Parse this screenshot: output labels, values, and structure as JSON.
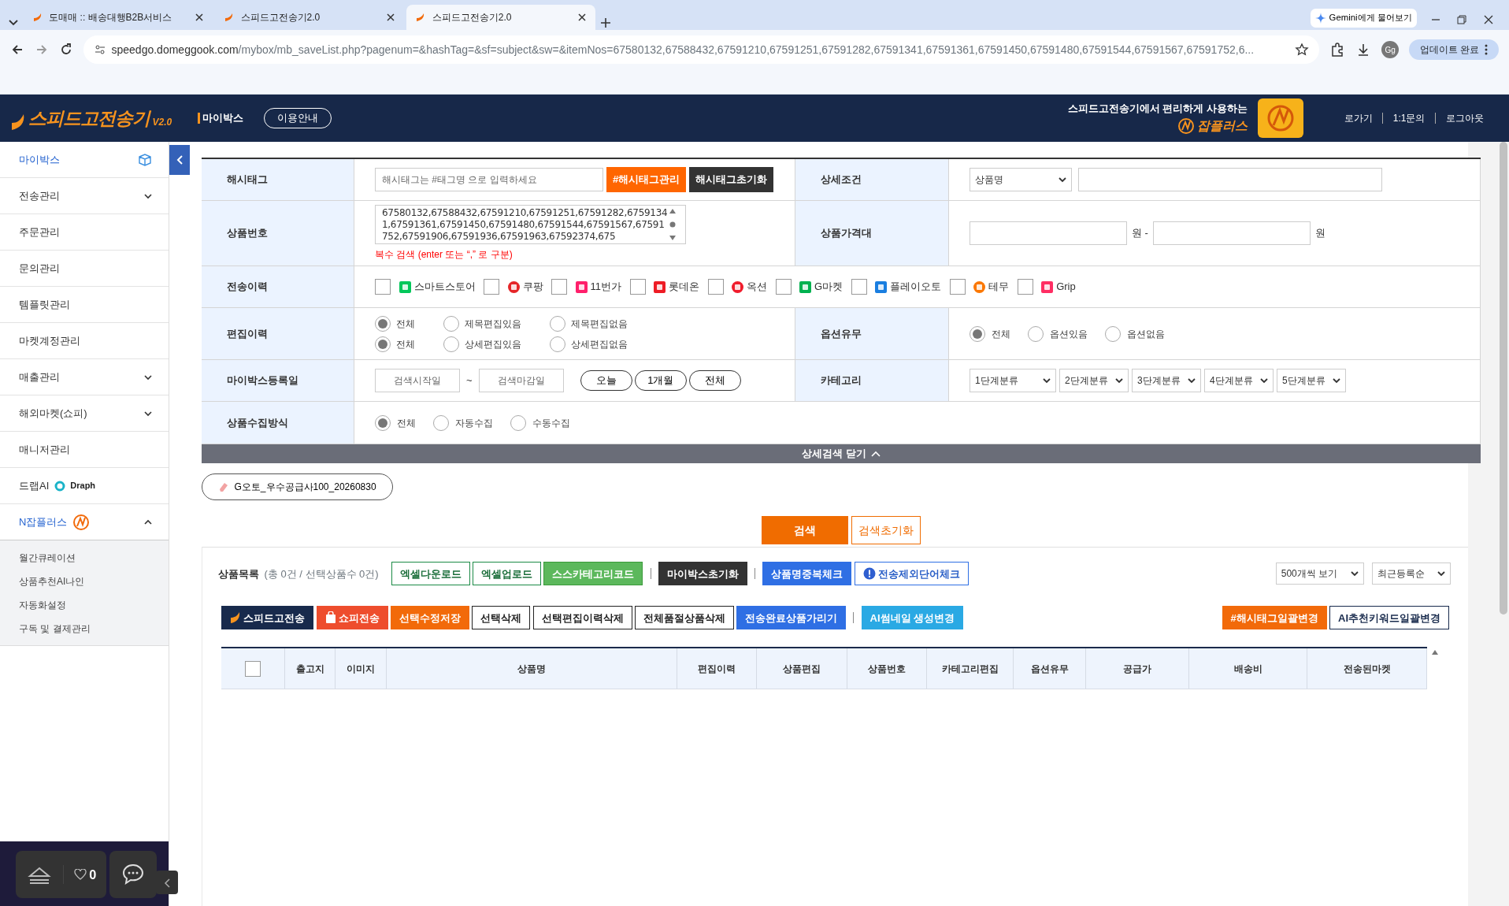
{
  "browser": {
    "tabs": [
      {
        "title": "도매매 :: 배송대행B2B서비스",
        "selected": false
      },
      {
        "title": "스피드고전송기2.0",
        "selected": false
      },
      {
        "title": "스피드고전송기2.0",
        "selected": true
      }
    ],
    "gemini": "Gemini에게 물어보기",
    "url_host": "speedgo.domeggook.com",
    "url_path": "/mybox/mb_saveList.php?pagenum=&hashTag=&sf=subject&sw=&itemNos=67580132,67588432,67591210,67591251,67591282,67591341,67591361,67591450,67591480,67591544,67591567,67591752,6...",
    "profile": "Gg",
    "update_button": "업데이트 완료"
  },
  "header": {
    "logo": "스피드고전송기",
    "version": "V2.0",
    "section": "마이박스",
    "guide_button": "이용안내",
    "promo_text": "스피드고전송기에서 편리하게 사용하는",
    "promo_brand": "잡플러스",
    "links": [
      "로가기",
      "1:1문의",
      "로그아웃"
    ]
  },
  "sidebar": {
    "items": [
      {
        "label": "마이박스",
        "kind": "home",
        "selected": true
      },
      {
        "label": "전송관리",
        "kind": "group",
        "selected": false,
        "expanded": false
      },
      {
        "label": "주문관리",
        "kind": "link",
        "selected": false
      },
      {
        "label": "문의관리",
        "kind": "link",
        "selected": false
      },
      {
        "label": "템플릿관리",
        "kind": "link",
        "selected": false
      },
      {
        "label": "마켓계정관리",
        "kind": "link",
        "selected": false
      },
      {
        "label": "매출관리",
        "kind": "group",
        "selected": false,
        "expanded": false
      },
      {
        "label": "해외마켓(쇼피)",
        "kind": "group",
        "selected": false,
        "expanded": false
      },
      {
        "label": "매니저관리",
        "kind": "link",
        "selected": false
      },
      {
        "label": "드랩AI",
        "kind": "draph",
        "brand": "Draph",
        "selected": false
      },
      {
        "label": "N잡플러스",
        "kind": "group",
        "selected": true,
        "expanded": true,
        "children": [
          "월간큐레이션",
          "상품추천AI나인",
          "자동화설정",
          "구독 및 결제관리"
        ]
      }
    ]
  },
  "search_form": {
    "hashtag": {
      "label": "해시태그",
      "placeholder": "해시태그는 #태그명 으로 입력하세요",
      "buttons": [
        "#해시태그관리",
        "해시태그초기화"
      ]
    },
    "detail": {
      "label": "상세조건",
      "select": "상품명"
    },
    "product_no": {
      "label": "상품번호",
      "value": "67580132,67588432,67591210,67591251,67591282,67591341,67591361,67591450,67591480,67591544,67591567,67591752,67591906,67591936,67591963,67592374,675",
      "hint": "복수 검색 (enter 또는 “,” 로 구분)"
    },
    "price": {
      "label": "상품가격대",
      "units": [
        "원 -",
        "원"
      ]
    },
    "markets": {
      "label": "전송이력",
      "items": [
        {
          "name": "스마트스토어",
          "checked": false,
          "color": "#03c75a"
        },
        {
          "name": "쿠팡",
          "checked": false,
          "color": "#e52528"
        },
        {
          "name": "11번가",
          "checked": false,
          "color": "#ff1f6b"
        },
        {
          "name": "롯데온",
          "checked": false,
          "color": "#ee1c25"
        },
        {
          "name": "옥션",
          "checked": false,
          "color": "#f01c2c"
        },
        {
          "name": "G마켓",
          "checked": false,
          "color": "#00b14f"
        },
        {
          "name": "플레이오토",
          "checked": false,
          "color": "#1a7ee0"
        },
        {
          "name": "테무",
          "checked": false,
          "color": "#fb7701"
        },
        {
          "name": "Grip",
          "checked": false,
          "color": "#ff2e63"
        }
      ]
    },
    "edit_history": {
      "label": "편집이력",
      "groups": [
        [
          {
            "label": "전체",
            "selected": true
          },
          {
            "label": "제목편집있음",
            "selected": false
          },
          {
            "label": "제목편집없음",
            "selected": false
          }
        ],
        [
          {
            "label": "전체",
            "selected": true
          },
          {
            "label": "상세편집있음",
            "selected": false
          },
          {
            "label": "상세편집없음",
            "selected": false
          }
        ]
      ]
    },
    "option": {
      "label": "옵션유무",
      "options": [
        {
          "label": "전체",
          "selected": true
        },
        {
          "label": "옵션있음",
          "selected": false
        },
        {
          "label": "옵션없음",
          "selected": false
        }
      ]
    },
    "registered": {
      "label": "마이박스등록일",
      "start_placeholder": "검색시작일",
      "tilde": "~",
      "end_placeholder": "검색마감일",
      "ranges": [
        "오늘",
        "1개월",
        "전체"
      ]
    },
    "category": {
      "label": "카테고리",
      "selects": [
        "1단계분류",
        "2단계분류",
        "3단계분류",
        "4단계분류",
        "5단계분류"
      ]
    },
    "collect": {
      "label": "상품수집방식",
      "options": [
        {
          "label": "전체",
          "selected": true
        },
        {
          "label": "자동수집",
          "selected": false
        },
        {
          "label": "수동수집",
          "selected": false
        }
      ]
    },
    "close_bar": "상세검색 닫기"
  },
  "saved_tag": "G오토_우수공급사100_20260830",
  "actions": [
    {
      "label": "검색",
      "kind": "primary"
    },
    {
      "label": "검색초기화",
      "kind": "outline"
    }
  ],
  "product_list": {
    "title": "상품목록",
    "summary": "(총 0건 / 선택상품수 0건)",
    "toolbar": [
      {
        "label": "엑셀다운로드",
        "kind": "outline-green"
      },
      {
        "label": "엑셀업로드",
        "kind": "outline-green"
      },
      {
        "label": "스스카테고리코드",
        "kind": "green"
      },
      {
        "label": "마이박스초기화",
        "kind": "dark",
        "divider": true
      },
      {
        "label": "상품명중복체크",
        "kind": "blue",
        "divider": true
      },
      {
        "label": "전송제외단어체크",
        "kind": "outline-blue"
      }
    ],
    "selects": [
      "500개씩 보기",
      "최근등록순"
    ],
    "actions": [
      {
        "label": "스피드고전송",
        "kind": "navy"
      },
      {
        "label": "쇼피전송",
        "kind": "shopee"
      },
      {
        "label": "선택수정저장",
        "kind": "orange"
      },
      {
        "label": "선택삭제",
        "kind": "white"
      },
      {
        "label": "선택편집이력삭제",
        "kind": "white"
      },
      {
        "label": "전체품절상품삭제",
        "kind": "white"
      },
      {
        "label": "전송완료상품가리기",
        "kind": "blue"
      },
      {
        "label": "AI썸네일 생성변경",
        "kind": "sky",
        "divider": true
      }
    ],
    "right_actions": [
      {
        "label": "#해시태그일괄변경",
        "kind": "orange"
      },
      {
        "label": "AI추천키워드일괄변경",
        "kind": "white-navy"
      }
    ],
    "select_all": {
      "checked": false
    },
    "columns": [
      "출고지",
      "이미지",
      "상품명",
      "편집이력",
      "상품편집",
      "상품번호",
      "카테고리편집",
      "옵션유무",
      "공급가",
      "배송비",
      "전송된마켓"
    ]
  },
  "widget": {
    "likes": "0"
  }
}
